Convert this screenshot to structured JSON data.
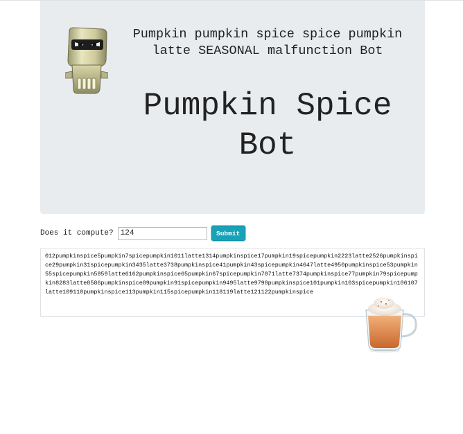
{
  "header": {
    "subtitle": "Pumpkin pumpkin spice spice pumpkin latte SEASONAL malfunction Bot",
    "title": "Pumpkin Spice Bot"
  },
  "form": {
    "label": "Does it compute?",
    "input_value": "124",
    "submit_label": "Submit"
  },
  "output": {
    "text": "012pumpkinspice5pumpkin7spicepumpkin1011latte1314pumpkinspice17pumpkin19spicepumpkin2223latte2526pumpkinspice29pumpkin31spicepumpkin3435latte3738pumpkinspice41pumpkin43spicepumpkin4647latte4950pumpkinspice53pumpkin55spicepumpkin5859latte6162pumpkinspice65pumpkin67spicepumpkin7071latte7374pumpkinspice77pumpkin79spicepumpkin8283latte8586pumpkinspice89pumpkin91spicepumpkin9495latte9798pumpkinspice101pumpkin103spicepumpkin106107latte109110pumpkinspice113pumpkin115spicepumpkin118119latte121122pumpkinspice"
  },
  "images": {
    "robot_icon": "robot-icon",
    "latte_icon": "pumpkin-spice-latte-icon"
  },
  "colors": {
    "jumbotron_bg": "#e9ecef",
    "submit_bg": "#17a2b8"
  }
}
